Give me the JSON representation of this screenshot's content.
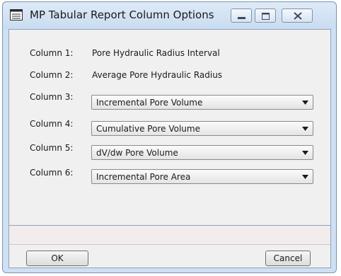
{
  "window": {
    "title": "MP Tabular Report Column Options"
  },
  "columns": [
    {
      "label": "Column 1:",
      "value": "Pore Hydraulic Radius Interval"
    },
    {
      "label": "Column 2:",
      "value": "Average Pore Hydraulic Radius"
    },
    {
      "label": "Column 3:",
      "value": "Incremental Pore Volume"
    },
    {
      "label": "Column 4:",
      "value": "Cumulative Pore Volume"
    },
    {
      "label": "Column 5:",
      "value": "dV/dw Pore Volume"
    },
    {
      "label": "Column 6:",
      "value": "Incremental Pore Area"
    }
  ],
  "buttons": {
    "ok": "OK",
    "cancel": "Cancel"
  },
  "icons": {
    "app": "window-app-icon",
    "minimize": "minimize-icon",
    "maximize": "maximize-icon",
    "close": "close-icon",
    "dropdown": "chevron-down-icon"
  },
  "colors": {
    "frame": "#cfe0f3",
    "panel": "#f0f0f0"
  }
}
